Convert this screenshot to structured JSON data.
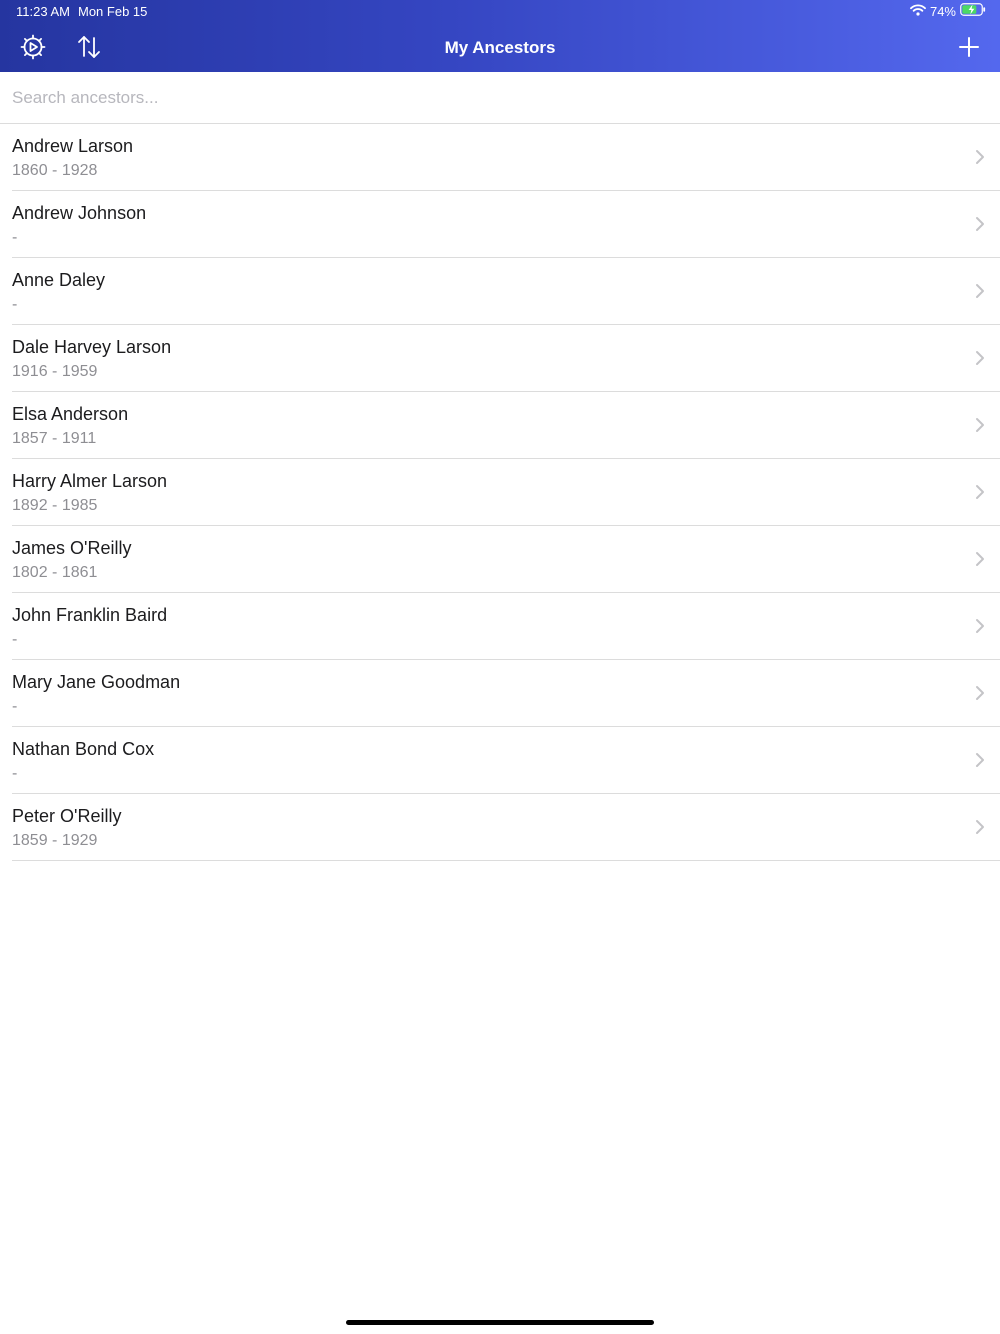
{
  "status_bar": {
    "time": "11:23 AM",
    "date": "Mon Feb 15",
    "battery": "74%",
    "icons": [
      "wifi-icon",
      "battery-charging-icon"
    ]
  },
  "nav": {
    "title": "My Ancestors",
    "left_icons": [
      "settings-gear-icon",
      "sort-arrows-icon"
    ],
    "right_icon": "plus-icon"
  },
  "search": {
    "placeholder": "Search ancestors...",
    "value": ""
  },
  "ancestors": [
    {
      "name": "Andrew Larson",
      "dates": "1860 - 1928"
    },
    {
      "name": "Andrew Johnson",
      "dates": "-"
    },
    {
      "name": "Anne Daley",
      "dates": "-"
    },
    {
      "name": "Dale Harvey Larson",
      "dates": "1916 - 1959"
    },
    {
      "name": "Elsa Anderson",
      "dates": "1857 - 1911"
    },
    {
      "name": "Harry Almer Larson",
      "dates": "1892 - 1985"
    },
    {
      "name": "James O'Reilly",
      "dates": "1802 - 1861"
    },
    {
      "name": "John Franklin Baird",
      "dates": "-"
    },
    {
      "name": "Mary Jane Goodman",
      "dates": "-"
    },
    {
      "name": "Nathan Bond Cox",
      "dates": "-"
    },
    {
      "name": "Peter O'Reilly",
      "dates": "1859 - 1929"
    }
  ],
  "colors": {
    "header_gradient_start": "#2535a0",
    "header_gradient_end": "#5468ee",
    "battery_charging": "#4cd964"
  }
}
